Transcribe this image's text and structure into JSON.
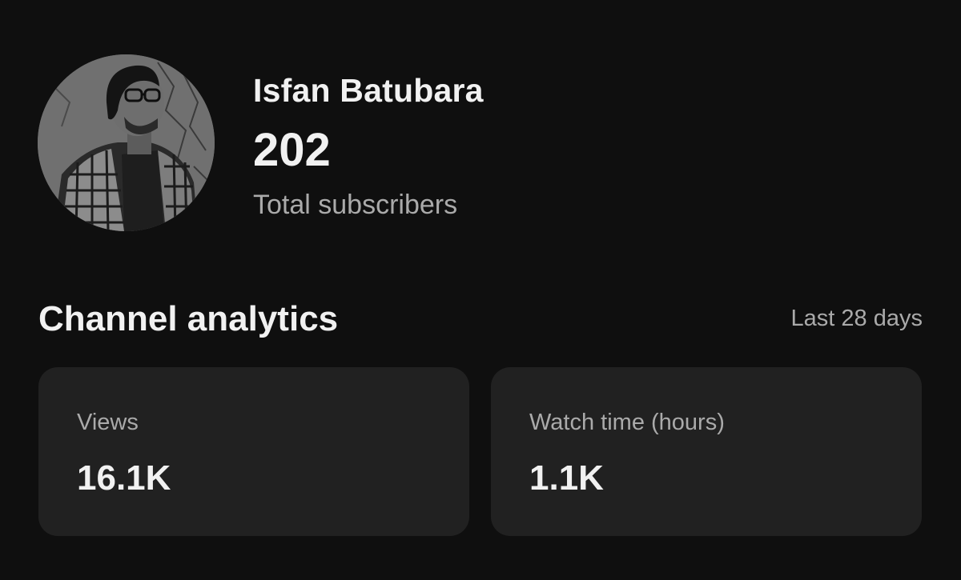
{
  "profile": {
    "channel_name": "Isfan Batubara",
    "subscriber_count": "202",
    "subscriber_label": "Total subscribers"
  },
  "analytics": {
    "title": "Channel analytics",
    "period": "Last 28 days",
    "cards": [
      {
        "label": "Views",
        "value": "16.1K"
      },
      {
        "label": "Watch time (hours)",
        "value": "1.1K"
      }
    ]
  }
}
